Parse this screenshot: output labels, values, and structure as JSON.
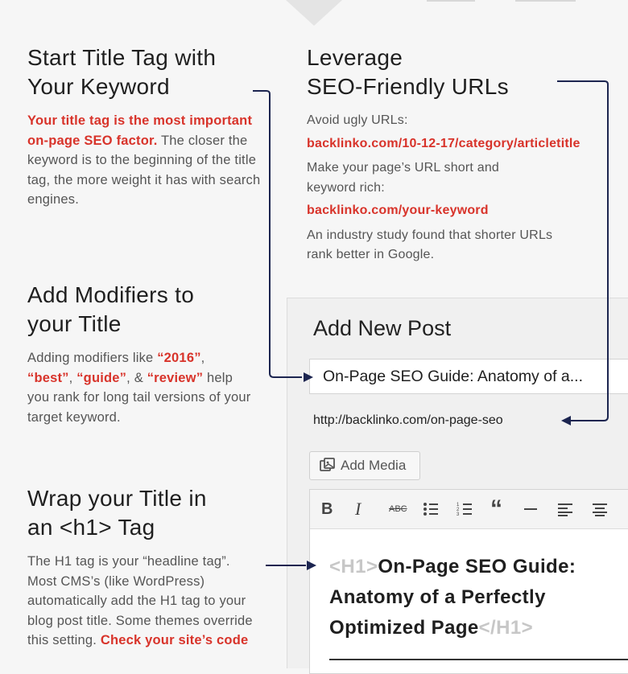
{
  "sections": {
    "start_title": {
      "heading": [
        "Start Title Tag with",
        "Your Keyword"
      ],
      "highlight": "Your title tag is the most important on-page SEO factor.",
      "body": "The closer the keyword is to the beginning of the title tag, the more weight it has with search engines."
    },
    "urls": {
      "heading": [
        "Leverage",
        "SEO-Friendly URLs"
      ],
      "line1": "Avoid ugly URLs:",
      "bad_url": "backlinko.com/10-12-17/category/articletitle",
      "line2": "Make your page’s URL short and keyword rich:",
      "good_url": "backlinko.com/your-keyword",
      "line3": "An industry study found that shorter URLs rank better in Google."
    },
    "modifiers": {
      "heading": [
        "Add Modifiers to",
        "your Title"
      ],
      "p1": "Adding modifiers like ",
      "m1": "“2016”",
      "sep1": ",",
      "m2": "“best”",
      "sep2": ", ",
      "m3": "“guide”",
      "sep3": ", & ",
      "m4": "“review”",
      "p2": " help you rank for long tail versions of your target keyword."
    },
    "h1": {
      "heading": [
        "Wrap your Title in",
        "an <h1> Tag"
      ],
      "body": "The H1 tag is your “headline tag”. Most CMS’s (like WordPress) automatically add the H1 tag to your blog post title. Some themes override this setting. ",
      "link": "Check your site’s code"
    }
  },
  "editor": {
    "panel_title": "Add New Post",
    "post_title": "On-Page SEO Guide: Anatomy of a...",
    "permalink": "http://backlinko.com/on-page-seo",
    "add_media": "Add Media",
    "toolbar": [
      "bold",
      "italic",
      "strikethrough",
      "bulleted-list",
      "numbered-list",
      "blockquote",
      "horizontal-rule",
      "align-left",
      "align-center"
    ],
    "h1_open": "<H1>",
    "h1_text": "On-Page SEO Guide: Anatomy of a Perfectly Optimized Page",
    "h1_close": "</H1>"
  },
  "colors": {
    "accent": "#d8332a",
    "arrow": "#1c2550",
    "text": "#555555",
    "heading": "#1f1f1f"
  }
}
